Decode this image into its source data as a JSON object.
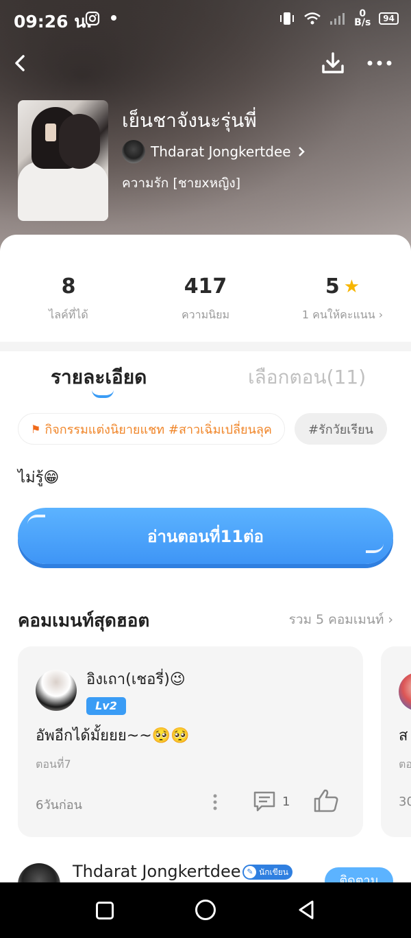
{
  "status": {
    "time": "09:26 น.",
    "net_speed_top": "0",
    "net_speed_bottom": "B/s",
    "battery": "94"
  },
  "story": {
    "title": "เย็นชาจังนะรุ่นพี่",
    "author": "Thdarat Jongkertdee",
    "genre": "ความรัก [ชายxหญิง]"
  },
  "stats": [
    {
      "value": "8",
      "label": "ไลค์ที่ได้"
    },
    {
      "value": "417",
      "label": "ความนิยม"
    },
    {
      "value": "5",
      "label": "1 คนให้คะแนน ›",
      "star": "★"
    }
  ],
  "tabs": {
    "detail": "รายละเอียด",
    "episodes": "เลือกตอน(11)"
  },
  "tags": {
    "activity": "กิจกรรมแต่งนิยายแชท #สาวเฉิ่มเปลี่ยนลุค",
    "plain": "#รักวัยเรียน"
  },
  "description": "ไม่รู้😁",
  "read_button": "อ่านตอนที่11ต่อ",
  "hot_comments": {
    "title": "คอมเมนท์สุดฮอต",
    "total": "รวม 5 คอมเมนท์ ›",
    "items": [
      {
        "name": "อิงเถา(เชอรี่)😉",
        "level": "Lv2",
        "text": "อัพอีกได้มั้ยยย~~🥺🥺",
        "episode": "ตอนที่7",
        "time": "6วันก่อน",
        "replies": "1"
      },
      {
        "text": "ส",
        "episode": "ตอ",
        "time": "30"
      }
    ]
  },
  "next_comment": {
    "name": "Thdarat Jongkertdee",
    "badge": "นักเขียน",
    "follow": "ติดตาม"
  },
  "colors": {
    "accent": "#3a9cf5",
    "tag_orange": "#f0862a",
    "star": "#f7b500"
  }
}
